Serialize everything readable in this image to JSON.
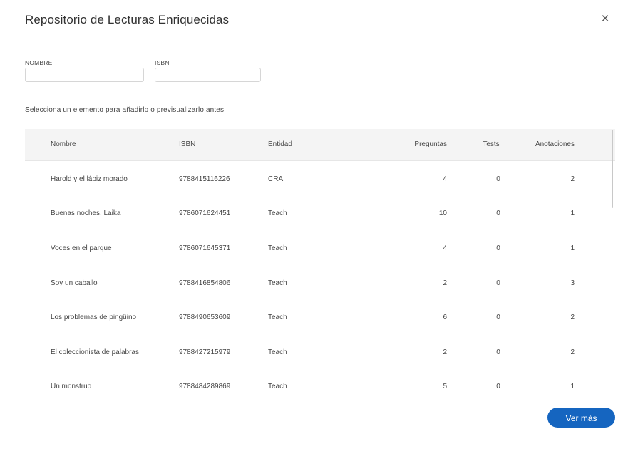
{
  "dialog": {
    "title": "Repositorio de Lecturas Enriquecidas",
    "close_glyph": "×",
    "close_icon": "close-icon"
  },
  "filters": {
    "nombre_label": "NOMBRE",
    "nombre_value": "",
    "isbn_label": "ISBN",
    "isbn_value": ""
  },
  "hint": "Selecciona un elemento para añadirlo o previsualizarlo antes.",
  "table": {
    "headers": {
      "nombre": "Nombre",
      "isbn": "ISBN",
      "entidad": "Entidad",
      "preguntas": "Preguntas",
      "tests": "Tests",
      "anotaciones": "Anotaciones"
    },
    "rows": [
      {
        "nombre": "Harold y el lápiz morado",
        "isbn": "9788415116226",
        "entidad": "CRA",
        "preguntas": "4",
        "tests": "0",
        "anotaciones": "2"
      },
      {
        "nombre": "Buenas noches, Laika",
        "isbn": "9786071624451",
        "entidad": "Teach",
        "preguntas": "10",
        "tests": "0",
        "anotaciones": "1"
      },
      {
        "nombre": "Voces en el parque",
        "isbn": "9786071645371",
        "entidad": "Teach",
        "preguntas": "4",
        "tests": "0",
        "anotaciones": "1"
      },
      {
        "nombre": "Soy un caballo",
        "isbn": "9788416854806",
        "entidad": "Teach",
        "preguntas": "2",
        "tests": "0",
        "anotaciones": "3"
      },
      {
        "nombre": "Los problemas de pingüino",
        "isbn": "9788490653609",
        "entidad": "Teach",
        "preguntas": "6",
        "tests": "0",
        "anotaciones": "2"
      },
      {
        "nombre": "El coleccionista de palabras",
        "isbn": "9788427215979",
        "entidad": "Teach",
        "preguntas": "2",
        "tests": "0",
        "anotaciones": "2"
      },
      {
        "nombre": "Un monstruo",
        "isbn": "9788484289869",
        "entidad": "Teach",
        "preguntas": "5",
        "tests": "0",
        "anotaciones": "1"
      }
    ]
  },
  "actions": {
    "more_label": "Ver más"
  },
  "colors": {
    "primary_button": "#1565c0",
    "header_background": "#f4f4f4"
  }
}
